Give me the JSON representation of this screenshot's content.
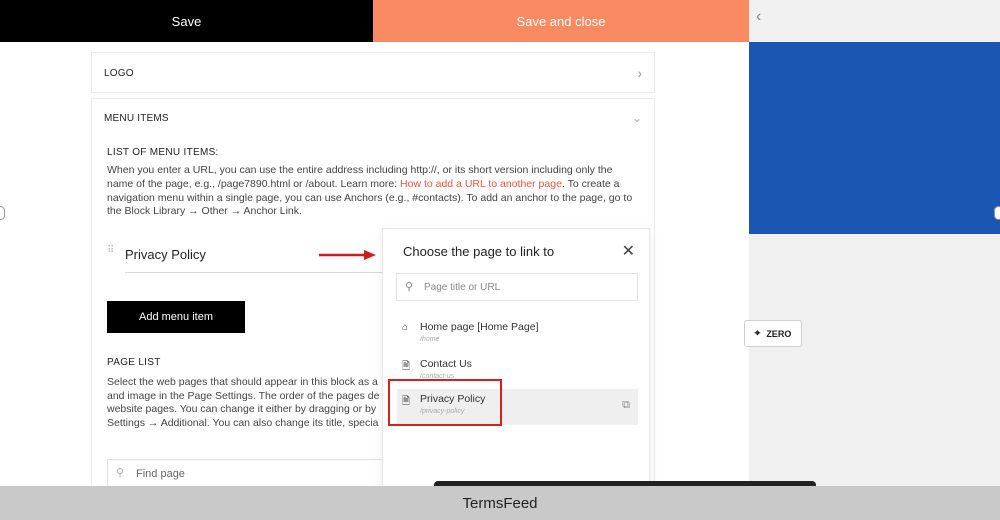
{
  "toolbar": {
    "save_label": "Save",
    "save_close_label": "Save and close",
    "collapse_icon": "chevron-left-icon"
  },
  "colors": {
    "accent": "#f98a62",
    "link": "#e9573f",
    "preview_blue": "#1c56b3",
    "highlight": "#d62121"
  },
  "preview": {
    "zero_label": "ZERO"
  },
  "sections": {
    "logo_title": "LOGO",
    "menu_items_title": "MENU ITEMS"
  },
  "menu": {
    "list_heading": "LIST OF MENU ITEMS:",
    "desc_before": "When you enter a URL, you can use the entire address including http://, or its short version including only the name of the page, e.g., /page7890.html or /about. Learn more: ",
    "desc_link": "How to add a URL to another page",
    "desc_after": ". To create a navigation menu within a single page, you can use Anchors (e.g., #contacts). To add an anchor to the page, go to the Block Library → Other → Anchor Link.",
    "item_name": "Privacy Policy",
    "add_button": "Add menu item"
  },
  "page_list": {
    "heading": "PAGE LIST",
    "lines": [
      "Select the web pages that should appear in this block as a",
      "and image in the Page Settings. The order of the pages de",
      "website pages. You can change it either by dragging or by",
      "Settings → Additional. You can also change its title, specia"
    ],
    "find_placeholder": "Find page"
  },
  "popup": {
    "title": "Choose the page to link to",
    "search_placeholder": "Page title or URL",
    "pages": [
      {
        "name": "Home page [Home Page]",
        "url": "/home",
        "icon": "house-icon"
      },
      {
        "name": "Contact Us",
        "url": "/contact-us",
        "icon": "page-icon"
      },
      {
        "name": "Privacy Policy",
        "url": "/privacy-policy",
        "icon": "page-icon"
      }
    ]
  },
  "footer": {
    "brand": "TermsFeed"
  }
}
